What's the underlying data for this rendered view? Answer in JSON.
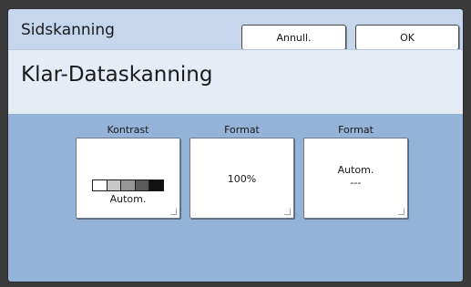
{
  "header": {
    "title": "Sidskanning",
    "cancel_label": "Annull.",
    "ok_label": "OK"
  },
  "subheader": {
    "title": "Klar-Dataskanning"
  },
  "settings": [
    {
      "label": "Kontrast",
      "value": "Autom.",
      "indicator": "contrast-scale"
    },
    {
      "label": "Format",
      "value": "100%"
    },
    {
      "label": "Format",
      "value": "Autom.",
      "subvalue": "---"
    }
  ],
  "contrast_scale_colors": [
    "#ffffff",
    "#c8c8c8",
    "#969696",
    "#5a5a5a",
    "#111111"
  ]
}
